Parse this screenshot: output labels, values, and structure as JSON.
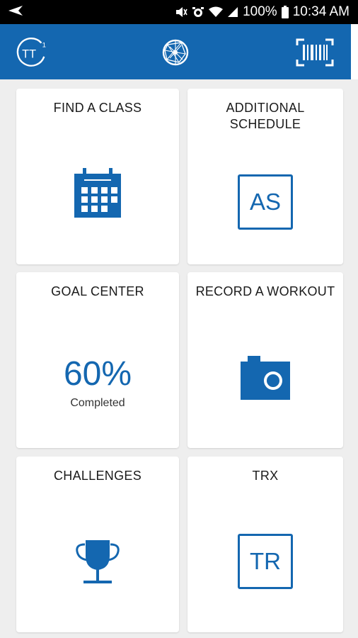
{
  "status_bar": {
    "battery_text": "100%",
    "time": "10:34 AM",
    "icons": [
      "back-arrow-icon",
      "mute-icon",
      "alarm-icon",
      "wifi-icon",
      "signal-icon",
      "battery-icon"
    ]
  },
  "header": {
    "logo_text": "TT",
    "logo_superscript": "1",
    "center_icon": "globe-icon",
    "right_icon": "barcode-scan-icon",
    "brand_color": "#1467b0"
  },
  "tiles": [
    {
      "id": "find-a-class",
      "title": "FIND A CLASS",
      "icon": "calendar-icon"
    },
    {
      "id": "additional-schedule",
      "title_line1": "ADDITIONAL",
      "title_line2": "SCHEDULE",
      "icon_text": "AS"
    },
    {
      "id": "goal-center",
      "title": "GOAL CENTER",
      "percent": "60%",
      "subtitle": "Completed"
    },
    {
      "id": "record-a-workout",
      "title": "RECORD A WORKOUT",
      "icon": "camera-icon"
    },
    {
      "id": "challenges",
      "title": "CHALLENGES",
      "icon": "trophy-icon"
    },
    {
      "id": "trx",
      "title": "TRX",
      "icon_text": "TR"
    }
  ]
}
